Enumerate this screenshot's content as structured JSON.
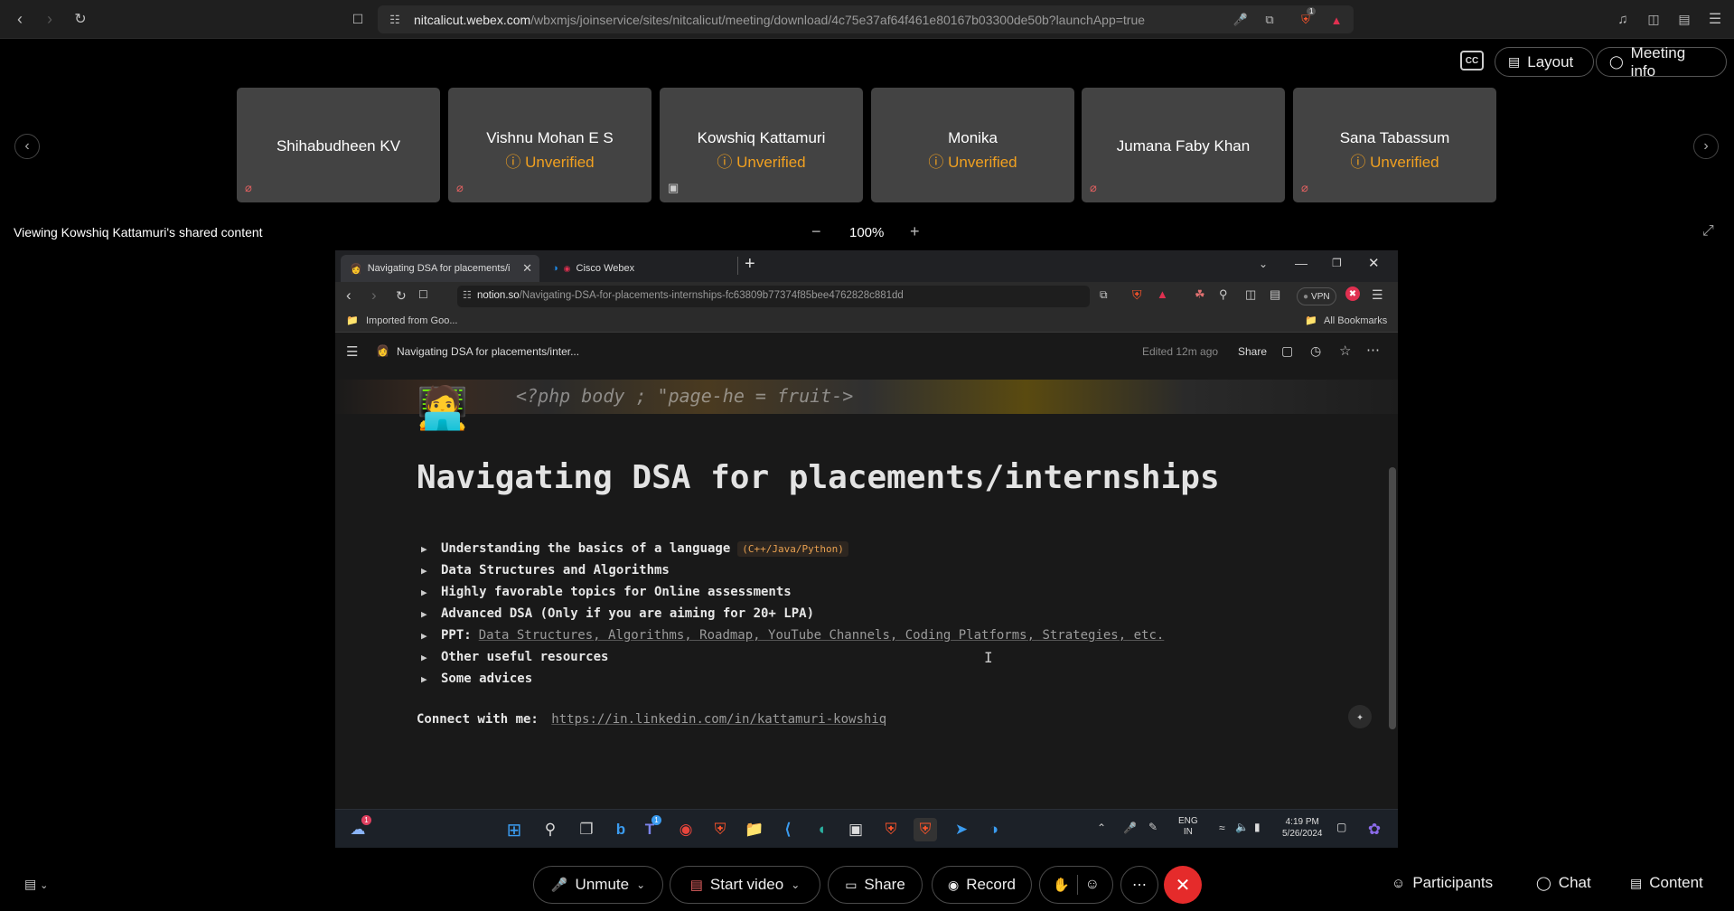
{
  "browser": {
    "url_host": "nitcalicut.webex.com",
    "url_path": "/wbxmjs/joinservice/sites/nitcalicut/meeting/download/4c75e37af64f461e80167b03300de50b?launchApp=true",
    "brave_badge": "1"
  },
  "meeting": {
    "cc_label": "CC",
    "layout_label": "Layout",
    "meeting_info_label": "Meeting info",
    "unverified_label": "Unverified",
    "participants": [
      {
        "name": "Shihabudheen KV",
        "unverified": false,
        "icon": "mic-muted-icon"
      },
      {
        "name": "Vishnu Mohan E S",
        "unverified": true,
        "icon": "mic-muted-icon"
      },
      {
        "name": "Kowshiq Kattamuri",
        "unverified": true,
        "icon": "screen-share-icon"
      },
      {
        "name": "Monika",
        "unverified": true,
        "icon": ""
      },
      {
        "name": "Jumana Faby Khan",
        "unverified": false,
        "icon": "mic-muted-icon"
      },
      {
        "name": "Sana Tabassum",
        "unverified": true,
        "icon": "mic-muted-icon"
      }
    ],
    "viewing_text": "Viewing Kowshiq Kattamuri's shared content",
    "zoom_level": "100%",
    "zoom_minus": "−",
    "zoom_plus": "+"
  },
  "shared": {
    "tabs": [
      {
        "title": "Navigating DSA for placements/i",
        "active": true
      },
      {
        "title": "Cisco Webex",
        "active": false
      }
    ],
    "new_tab": "+",
    "url_host": "notion.so",
    "url_path": "/Navigating-DSA-for-placements-internships-fc63809b77374f85bee4762828c881dd",
    "vpn_label": "VPN",
    "bookmark_left": "Imported from Goo...",
    "bookmark_right": "All Bookmarks",
    "notion_title": "Navigating DSA for placements/inter...",
    "edited": "Edited 12m ago",
    "share": "Share",
    "cover_code": "<?php body ;  \"page-he  =  fruit->",
    "page_title": "Navigating DSA for placements/internships",
    "toggles": [
      {
        "text": "Understanding the basics of a language",
        "tag": "(C++/Java/Python)"
      },
      {
        "text": "Data Structures and Algorithms",
        "tag": ""
      },
      {
        "text": "Highly favorable topics for Online assessments",
        "tag": ""
      },
      {
        "text": "Advanced DSA (Only if you are aiming for 20+ LPA)",
        "tag": ""
      },
      {
        "text": "PPT:",
        "light": "Data Structures, Algorithms, Roadmap, YouTube Channels, Coding Platforms, Strategies, etc."
      },
      {
        "text": "Other useful resources",
        "tag": ""
      },
      {
        "text": "Some advices",
        "tag": ""
      }
    ],
    "connect_label": "Connect with me:",
    "connect_link": "https://in.linkedin.com/in/kattamuri-kowshiq",
    "taskbar": {
      "lang1": "ENG",
      "lang2": "IN",
      "time": "4:19 PM",
      "date": "5/26/2024",
      "weather_badge": "1",
      "teams_badge": "1"
    }
  },
  "controls": {
    "unmute": "Unmute",
    "start_video": "Start video",
    "share": "Share",
    "record": "Record",
    "participants": "Participants",
    "chat": "Chat",
    "content": "Content"
  },
  "colors": {
    "unverified": "#f0a020",
    "leave": "#e52b2b",
    "muted": "#e06060"
  }
}
